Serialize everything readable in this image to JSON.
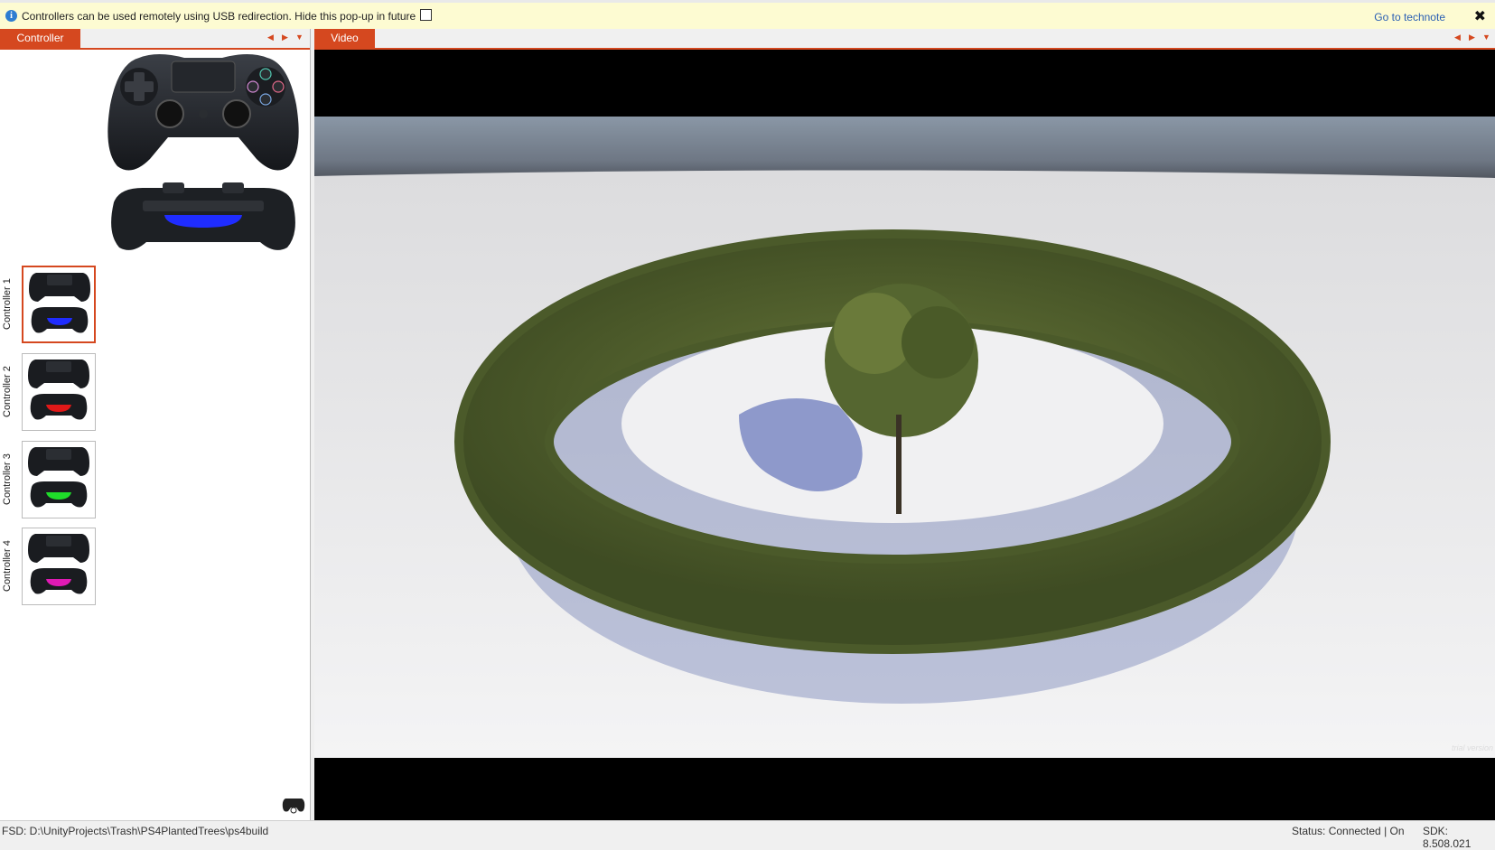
{
  "notification": {
    "message": "Controllers can be used remotely using USB redirection. Hide this pop-up in future",
    "link": "Go to technote",
    "close_glyph": "✖",
    "info_glyph": "i"
  },
  "left_panel": {
    "tab_label": "Controller",
    "controllers": [
      {
        "label": "Controller 1",
        "light_color": "#1f2cff",
        "selected": true
      },
      {
        "label": "Controller 2",
        "light_color": "#e01818",
        "selected": false
      },
      {
        "label": "Controller 3",
        "light_color": "#1fdc2a",
        "selected": false
      },
      {
        "label": "Controller 4",
        "light_color": "#e01ab4",
        "selected": false
      }
    ],
    "main_light_color": "#1f2cff"
  },
  "right_panel": {
    "tab_label": "Video",
    "watermark": "trial version"
  },
  "statusbar": {
    "fsd_path": "FSD: D:\\UnityProjects\\Trash\\PS4PlantedTrees\\ps4build",
    "status": "Status: Connected | On",
    "sdk": "SDK: 8.508.021"
  },
  "colors": {
    "accent": "#d5481f",
    "notify_bg": "#fdfbd2",
    "link": "#2a5fb3"
  }
}
